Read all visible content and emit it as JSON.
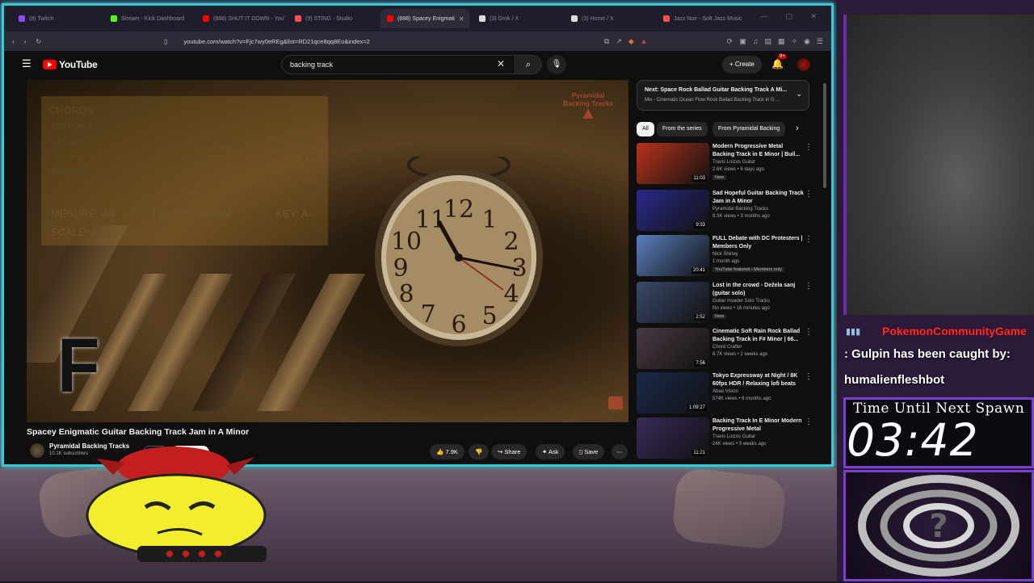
{
  "browser": {
    "tabs": [
      {
        "label": "(8) Twitch",
        "favicon_color": "#9146ff",
        "active": false
      },
      {
        "label": "Stream - Kick Dashboard",
        "favicon_color": "#53fc18",
        "active": false
      },
      {
        "label": "(888) SHUT IT DOWN - YouTu",
        "favicon_color": "#ff0000",
        "active": false
      },
      {
        "label": "(9) STING - Studio",
        "favicon_color": "#ff4d4d",
        "active": false
      },
      {
        "label": "(888) Spacey Enigmati",
        "favicon_color": "#ff0000",
        "active": true
      },
      {
        "label": "(3) Grok / X",
        "favicon_color": "#dddddd",
        "active": false
      },
      {
        "label": "(3) Home / X",
        "favicon_color": "#dddddd",
        "active": false
      },
      {
        "label": "Jazz Noir - Soft Jazz Music",
        "favicon_color": "#ff4d4d",
        "active": false
      }
    ],
    "url": "youtube.com/watch?v=Fjc7wy0eREg&list=RD21qce8qq8Eo&index=2"
  },
  "youtube": {
    "logo_text": "YouTube",
    "search_value": "backing track",
    "create_label": "Create",
    "notif_badge": "9+",
    "video": {
      "title": "Spacey Enigmatic Guitar Backing Track Jam in A Minor",
      "channel": "Pyramidal Backing Tracks",
      "subscribers": "10.1K subscribers",
      "join_label": "Join",
      "subscribe_label": "Subscribe",
      "likes": "7.9K",
      "share_label": "Share",
      "ask_label": "Ask",
      "save_label": "Save"
    },
    "overlay": {
      "chords_title": "CHORDS",
      "section_a": "SECTION A",
      "row1": [
        "|| A-add9",
        "| A 9",
        "| A-add9 (b13)",
        "| %",
        "|| X4"
      ],
      "row2": [
        "|| A-add9",
        "| %",
        "| A 9",
        "| %",
        "|| X4"
      ],
      "section_b": "SECTION B",
      "row3": [
        "|| F",
        "| D",
        "| A-",
        "| G",
        "|| X6"
      ],
      "measure": "MESURE: 4/4",
      "tempo": "TEMPO: 73 BPM",
      "key": "KEY: A-",
      "scale": "SCALE: A Aeolian",
      "big_chord": "F",
      "brand_line1": "Pyramidal",
      "brand_line2": "Backing Tracks"
    },
    "up_next": {
      "title": "Next: Space Rock Ballad Guitar Backing Track A Mi...",
      "subtitle": "Mix - Cinematic Ocean Flow Rock Ballad Backing Track in G ..."
    },
    "chips": [
      "All",
      "From the series",
      "From Pyramidal Backing"
    ],
    "recommendations": [
      {
        "title": "Modern Progressive Metal Backing Track in E Minor | Buil...",
        "channel": "Travis Loizos Guitar",
        "meta": "2.6K views • 6 days ago",
        "badge": "New",
        "duration": "11:03",
        "thumb": "#b8331c"
      },
      {
        "title": "Sad Hopeful Guitar Backing Track Jam in A Minor",
        "channel": "Pyramidal Backing Tracks",
        "meta": "8.3K views • 3 months ago",
        "badge": "",
        "duration": "9:33",
        "thumb": "#2a2a8a"
      },
      {
        "title": "FULL Debate with DC Protesters | Members Only",
        "channel": "Nick Shirley",
        "meta": "1 month ago",
        "badge": "YouTube featured • Members only",
        "duration": "20:41",
        "thumb": "#5a7fc0"
      },
      {
        "title": "Lost in the crowd - Dežela sanj (guitar solo)",
        "channel": "Guitar Invader Solo Tracks",
        "meta": "No views • 16 minutes ago",
        "badge": "New",
        "duration": "2:52",
        "thumb": "#3a4a6a"
      },
      {
        "title": "Cinematic Soft Rain Rock Ballad Backing Track in F# Minor | 66...",
        "channel": "Chord Crafter",
        "meta": "8.7K views • 2 weeks ago",
        "badge": "",
        "duration": "7:56",
        "thumb": "#4a3a44"
      },
      {
        "title": "Tokyo Expressway at Night / 8K 60fps HDR / Relaxing lofi beats",
        "channel": "Abao Vision",
        "meta": "574K views • 6 months ago",
        "badge": "",
        "duration": "1:09:27",
        "thumb": "#1a2a4a"
      },
      {
        "title": "Backing Track In E Minor Modern Progressive Metal",
        "channel": "Travis Loizos Guitar",
        "meta": "24K views • 3 weeks ago",
        "badge": "",
        "duration": "11:21",
        "thumb": "#3a2a5a"
      }
    ]
  },
  "stream": {
    "chat_sender": "PokemonCommunityGame",
    "chat_line1": ": Gulpin has been caught by:",
    "chat_line2": "humalienfleshbot",
    "timer_label": "Time Until Next Spawn",
    "timer_value": "03:42"
  }
}
